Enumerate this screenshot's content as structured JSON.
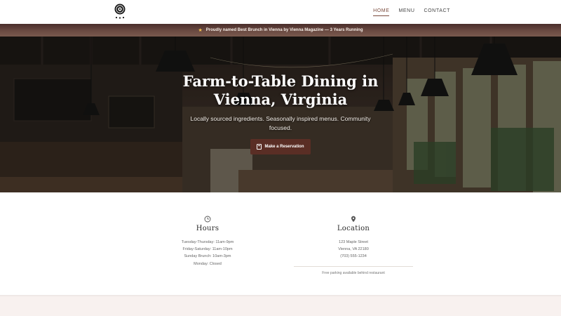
{
  "header": {
    "logo_icon": "restaurant-crest-logo",
    "nav": [
      {
        "label": "HOME",
        "active": true
      },
      {
        "label": "MENU",
        "active": false
      },
      {
        "label": "CONTACT",
        "active": false
      }
    ]
  },
  "announcement": {
    "icon": "star-icon",
    "text": "Proudly named Best Brunch in Vienna by Vienna Magazine — 3 Years Running"
  },
  "hero": {
    "title": "Farm-to-Table Dining in Vienna, Virginia",
    "subtitle": "Locally sourced ingredients. Seasonally inspired menus. Community focused.",
    "cta_label": "Make a Reservation",
    "cta_icon": "calendar-icon"
  },
  "hours": {
    "icon": "clock-icon",
    "title": "Hours",
    "lines": [
      "Tuesday-Thursday: 11am-9pm",
      "Friday-Saturday: 11am-10pm",
      "Sunday Brunch: 10am-3pm",
      "Monday: Closed"
    ]
  },
  "location": {
    "icon": "map-pin-icon",
    "title": "Location",
    "lines": [
      "123 Maple Street",
      "Vienna, VA 22180",
      "(703) 555-1234"
    ],
    "note": "Free parking available behind restaurant"
  },
  "colors": {
    "accent": "#5a2e25",
    "announcement_bg": "#6a4a42",
    "star": "#f2c14e"
  }
}
